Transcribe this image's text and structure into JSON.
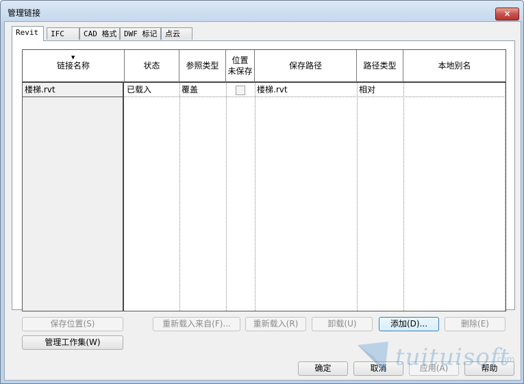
{
  "window": {
    "title": "管理链接",
    "close_label": "×"
  },
  "tabs": [
    {
      "label": "Revit",
      "active": true
    },
    {
      "label": "IFC",
      "active": false
    },
    {
      "label": "CAD 格式",
      "active": false
    },
    {
      "label": "DWF 标记",
      "active": false
    },
    {
      "label": "点云",
      "active": false
    }
  ],
  "table": {
    "sort_indicator": "▼",
    "columns": [
      "链接名称",
      "状态",
      "参照类型",
      "位置\n未保存",
      "保存路径",
      "路径类型",
      "本地别名"
    ],
    "rows": [
      {
        "name": "楼梯.rvt",
        "status": "已载入",
        "ref_type": "覆盖",
        "position_unsaved": false,
        "saved_path": "楼梯.rvt",
        "path_type": "相对",
        "local_alias": ""
      }
    ]
  },
  "buttons": {
    "save_positions": "保存位置(S)",
    "reload_from": "重新载入来自(F)...",
    "reload": "重新载入(R)",
    "unload": "卸载(U)",
    "add": "添加(D)...",
    "remove": "删除(E)",
    "manage_worksets": "管理工作集(W)",
    "ok": "确定",
    "cancel": "取消",
    "apply": "应用(A)",
    "help": "帮助"
  },
  "watermark": {
    "text": "tuituisoft",
    "suffix": ".com"
  }
}
